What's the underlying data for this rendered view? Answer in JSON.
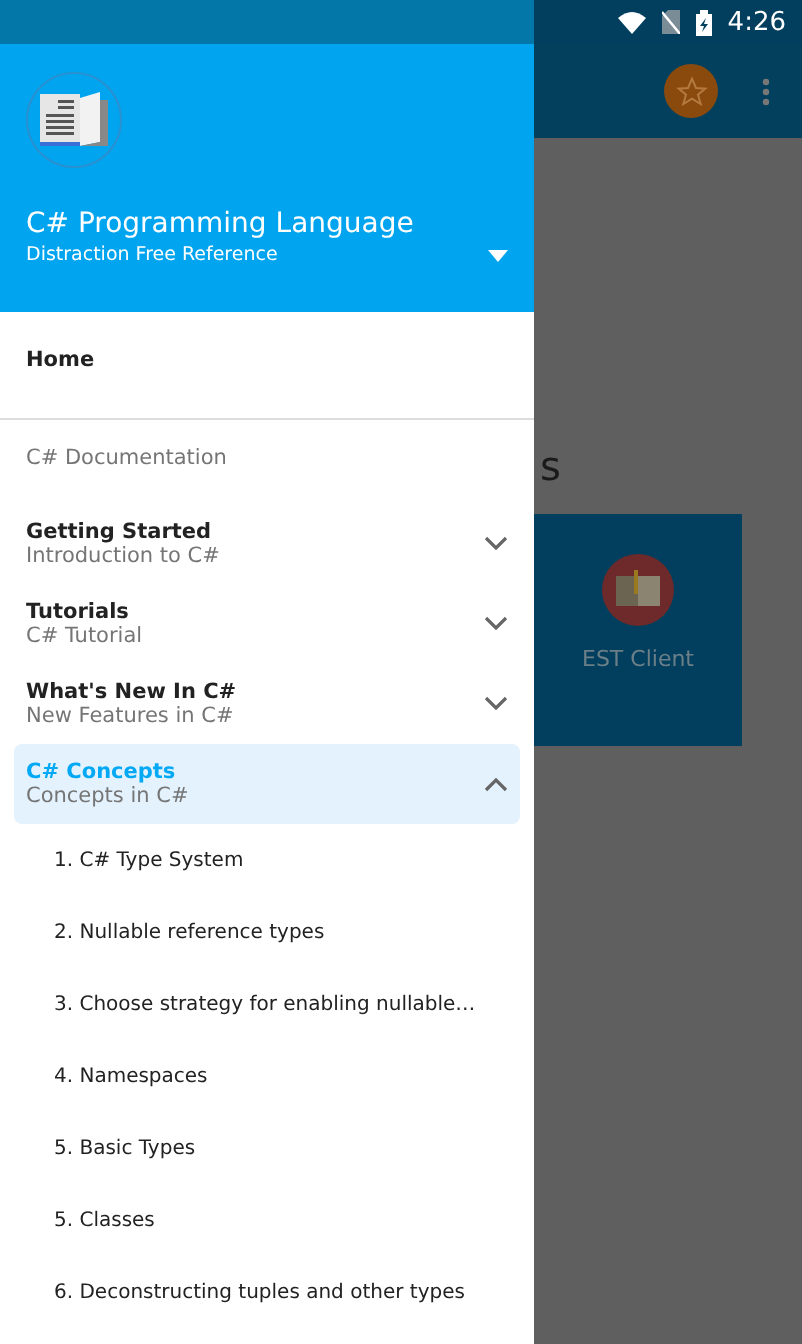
{
  "status_bar": {
    "time": "4:26"
  },
  "background_app": {
    "heading": "s",
    "card": {
      "label": "EST Client"
    }
  },
  "drawer": {
    "header": {
      "title": "C# Programming Language",
      "subtitle": "Distraction Free Reference"
    },
    "home": {
      "label": "Home"
    },
    "section": "C# Documentation",
    "groups": [
      {
        "title": "Getting Started",
        "subtitle": "Introduction to C#",
        "expanded": false
      },
      {
        "title": "Tutorials",
        "subtitle": "C# Tutorial",
        "expanded": false
      },
      {
        "title": "What's New In C#",
        "subtitle": "New Features in C#",
        "expanded": false
      },
      {
        "title": "C# Concepts",
        "subtitle": "Concepts in C#",
        "expanded": true,
        "children": [
          {
            "label": "1. C# Type System"
          },
          {
            "label": "2. Nullable reference types"
          },
          {
            "label": "3. Choose strategy for enabling nullable…"
          },
          {
            "label": "4. Namespaces"
          },
          {
            "label": "5. Basic Types"
          },
          {
            "label": "5. Classes"
          },
          {
            "label": "6. Deconstructing tuples and other types"
          }
        ]
      }
    ]
  }
}
